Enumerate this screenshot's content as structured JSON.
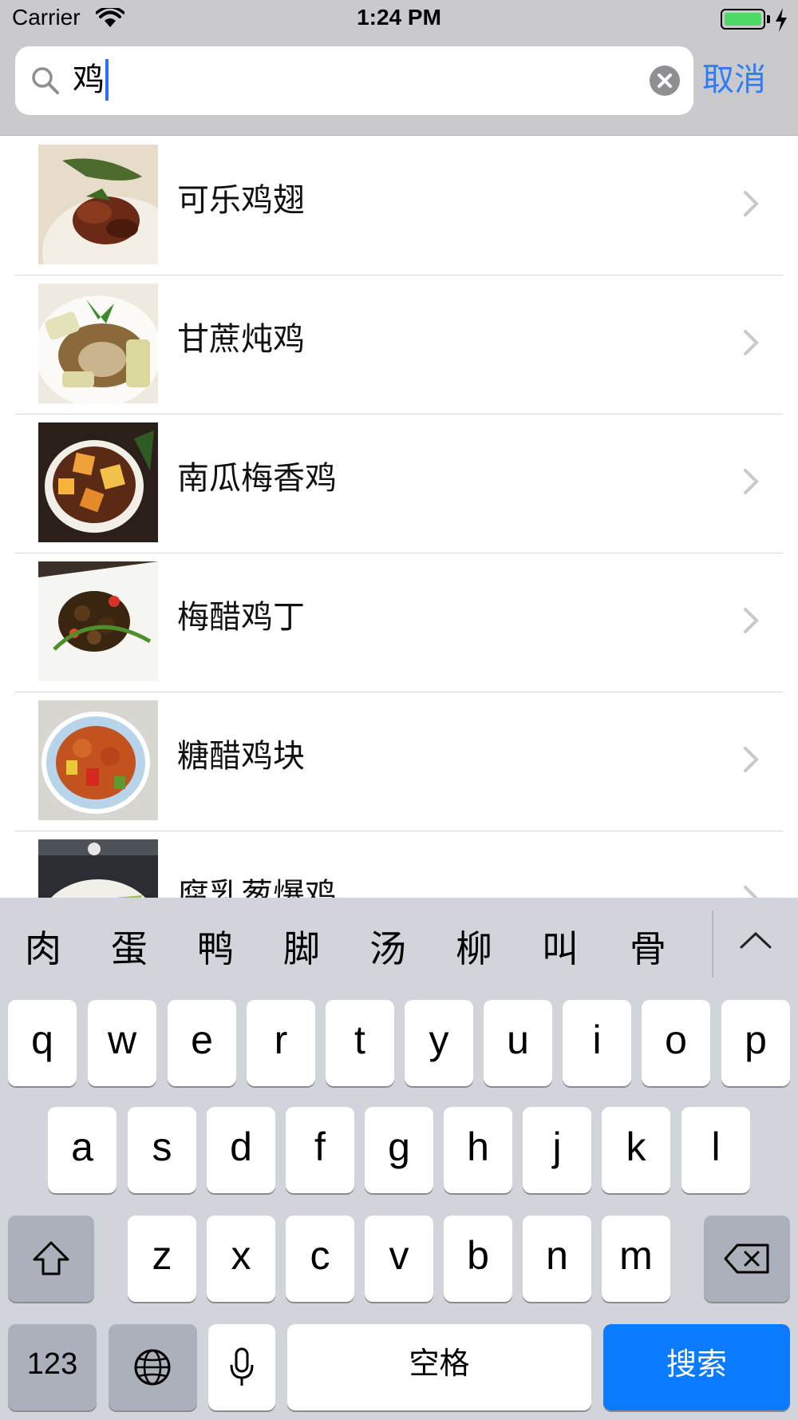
{
  "status_bar": {
    "carrier": "Carrier",
    "time": "1:24 PM",
    "battery_color": "#4cd964"
  },
  "search": {
    "value": "鸡",
    "cancel_label": "取消",
    "accent_color": "#2f7cf6"
  },
  "results": [
    {
      "title": "可乐鸡翅",
      "thumb": "dish-photo"
    },
    {
      "title": "甘蔗炖鸡",
      "thumb": "dish-photo"
    },
    {
      "title": "南瓜梅香鸡",
      "thumb": "dish-photo"
    },
    {
      "title": "梅醋鸡丁",
      "thumb": "dish-photo"
    },
    {
      "title": "糖醋鸡块",
      "thumb": "dish-photo"
    },
    {
      "title": "腐乳葱爆鸡",
      "thumb": "dish-photo"
    }
  ],
  "keyboard": {
    "candidates": [
      "肉",
      "蛋",
      "鸭",
      "脚",
      "汤",
      "柳",
      "叫",
      "骨"
    ],
    "row1": [
      "q",
      "w",
      "e",
      "r",
      "t",
      "y",
      "u",
      "i",
      "o",
      "p"
    ],
    "row2": [
      "a",
      "s",
      "d",
      "f",
      "g",
      "h",
      "j",
      "k",
      "l"
    ],
    "row3": [
      "z",
      "x",
      "c",
      "v",
      "b",
      "n",
      "m"
    ],
    "numbers_label": "123",
    "space_label": "空格",
    "search_label": "搜索",
    "search_key_color": "#0a7afe"
  }
}
